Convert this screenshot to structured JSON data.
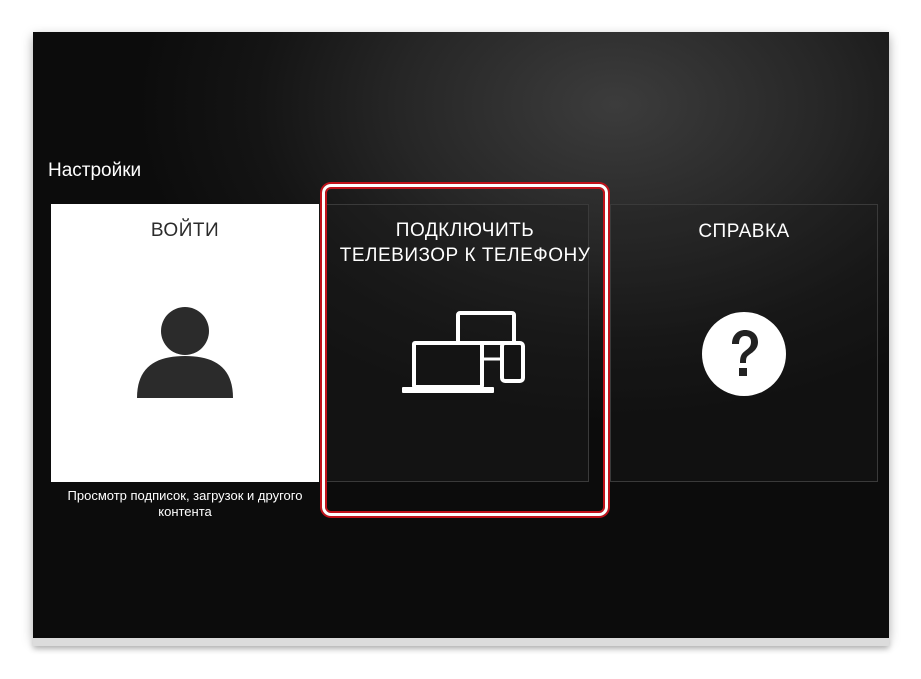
{
  "settings": {
    "title": "Настройки"
  },
  "tiles": [
    {
      "label": "ВОЙТИ",
      "description": "Просмотр подписок, загрузок и другого контента",
      "icon": "person-icon"
    },
    {
      "label_line1": "ПОДКЛЮЧИТЬ",
      "label_line2": "ТЕЛЕВИЗОР К ТЕЛЕФОНУ",
      "icon": "devices-icon",
      "focused": true
    },
    {
      "label": "СПРАВКА",
      "icon": "help-icon"
    }
  ],
  "colors": {
    "focus_ring": "#c0121b",
    "background": "#1a1a1a",
    "signin_tile": "#ffffff"
  }
}
